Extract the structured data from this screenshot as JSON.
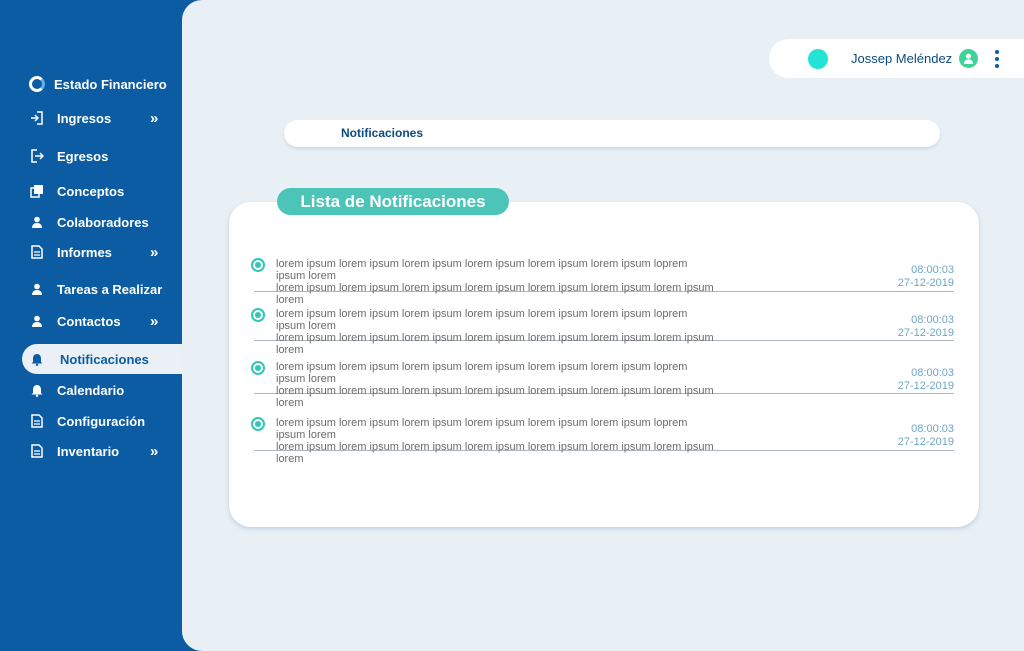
{
  "sidebar": {
    "brand": "Estado Financiero",
    "items": [
      {
        "label": "Ingresos",
        "icon": "sign-in-icon",
        "chevron": "»"
      },
      {
        "label": "Egresos",
        "icon": "sign-out-icon",
        "chevron": ""
      },
      {
        "label": "Conceptos",
        "icon": "copy-icon",
        "chevron": ""
      },
      {
        "label": "Colaboradores",
        "icon": "user-icon",
        "chevron": ""
      },
      {
        "label": "Informes",
        "icon": "document-icon",
        "chevron": "»"
      },
      {
        "label": "Tareas a Realizar",
        "icon": "user-icon",
        "chevron": ""
      },
      {
        "label": "Contactos",
        "icon": "user-icon",
        "chevron": "»"
      },
      {
        "label": "Notificaciones",
        "icon": "bell-icon",
        "chevron": "",
        "active": true
      },
      {
        "label": "Calendario",
        "icon": "bell-icon",
        "chevron": ""
      },
      {
        "label": "Configuración",
        "icon": "document-icon",
        "chevron": ""
      },
      {
        "label": "Inventario",
        "icon": "document-icon",
        "chevron": "»"
      }
    ]
  },
  "header": {
    "user_name": "Jossep Meléndez",
    "status_color": "#22e3d4"
  },
  "breadcrumb": "Notificaciones",
  "notifications": {
    "title": "Lista de Notificaciones",
    "items": [
      {
        "line1": "lorem ipsum lorem ipsum lorem ipsum lorem ipsum lorem ipsum lorem ipsum loprem ipsum lorem",
        "line2": "lorem ipsum lorem ipsum lorem ipsum lorem ipsum lorem ipsum lorem ipsum lorem ipsum lorem",
        "time": "08:00:03",
        "date": "27-12-2019"
      },
      {
        "line1": "lorem ipsum lorem ipsum lorem ipsum lorem ipsum lorem ipsum lorem ipsum loprem ipsum lorem",
        "line2": "lorem ipsum lorem ipsum lorem ipsum lorem ipsum lorem ipsum lorem ipsum lorem ipsum lorem",
        "time": "08:00:03",
        "date": "27-12-2019"
      },
      {
        "line1": "lorem ipsum lorem ipsum lorem ipsum lorem ipsum lorem ipsum lorem ipsum loprem ipsum lorem",
        "line2": "lorem ipsum lorem ipsum lorem ipsum lorem ipsum lorem ipsum lorem ipsum lorem ipsum lorem",
        "time": "08:00:03",
        "date": "27-12-2019"
      },
      {
        "line1": "lorem ipsum lorem ipsum lorem ipsum lorem ipsum lorem ipsum lorem ipsum loprem ipsum lorem",
        "line2": "lorem ipsum lorem ipsum lorem ipsum lorem ipsum lorem ipsum lorem ipsum lorem ipsum lorem",
        "time": "08:00:03",
        "date": "27-12-2019"
      }
    ]
  },
  "colors": {
    "sidebar": "#0b5ca3",
    "accent": "#4cc4b8",
    "background": "#e9f0f5"
  }
}
